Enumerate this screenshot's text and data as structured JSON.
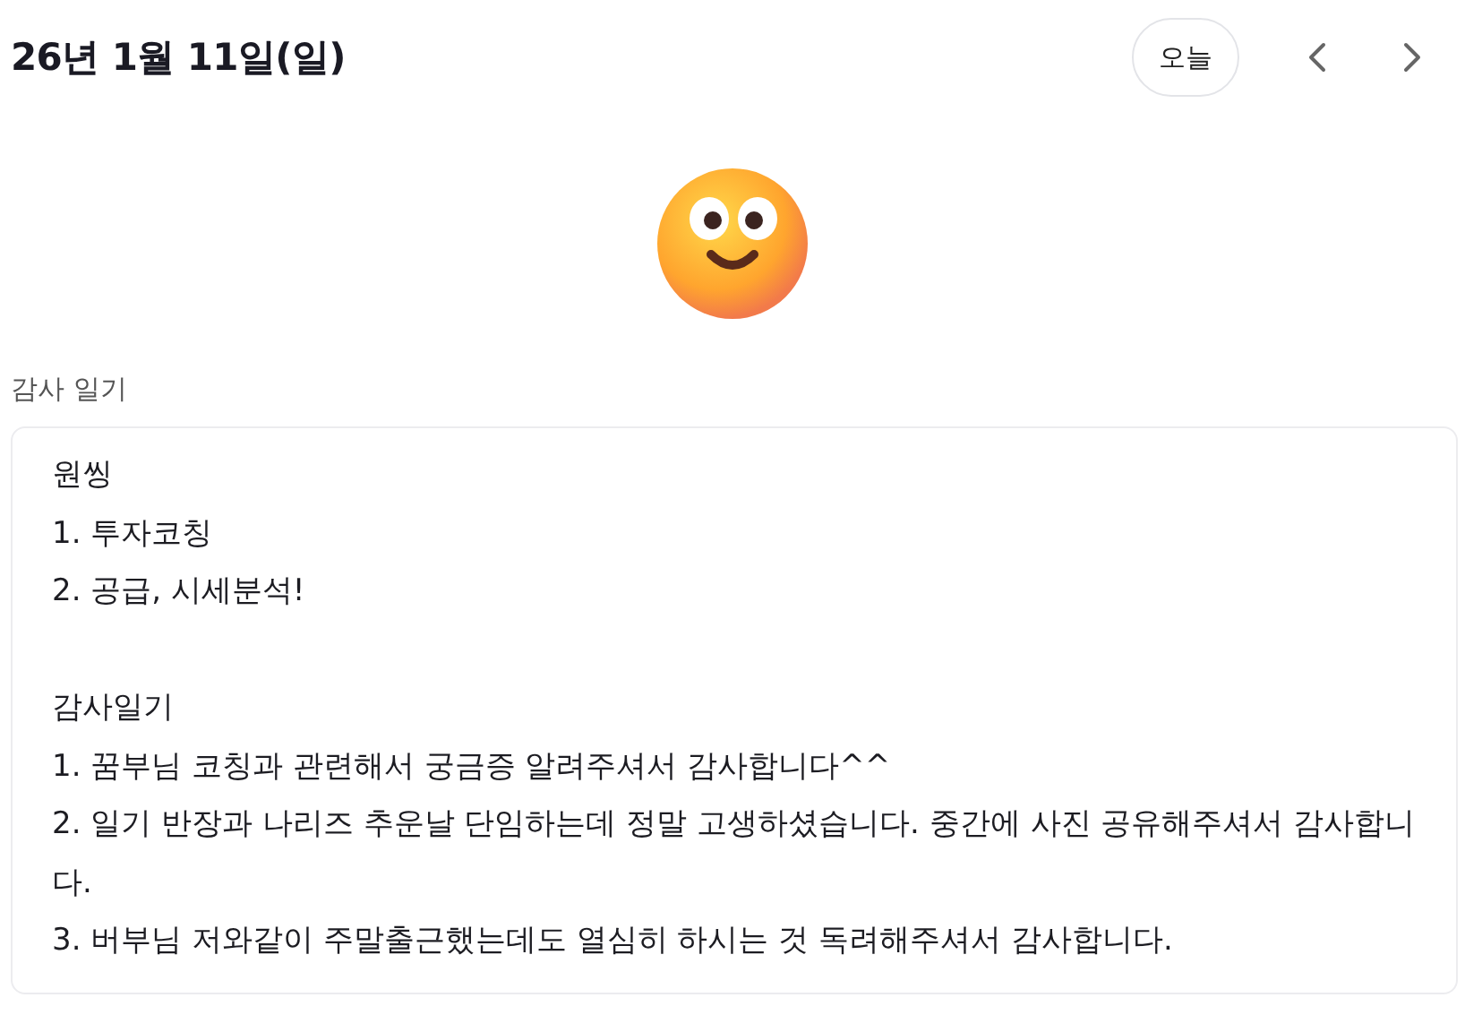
{
  "header": {
    "date": "26년 1월 11일(일)",
    "today_button": "오늘"
  },
  "section_label": "감사 일기",
  "note": {
    "paragraphs": [
      {
        "lines": [
          "원씽",
          "1. 투자코칭",
          "2. 공급, 시세분석!"
        ]
      },
      {
        "lines": [
          "감사일기",
          "1. 꿈부님 코칭과 관련해서 궁금증 알려주셔서 감사합니다^^",
          "2. 일기 반장과 나리즈 추운날 단임하는데 정말 고생하셨습니다. 중간에 사진 공유해주셔서 감사합니다.",
          "3. 버부님 저와같이 주말출근했는데도 열심히 하시는 것 독려해주셔서 감사합니다."
        ]
      }
    ]
  }
}
